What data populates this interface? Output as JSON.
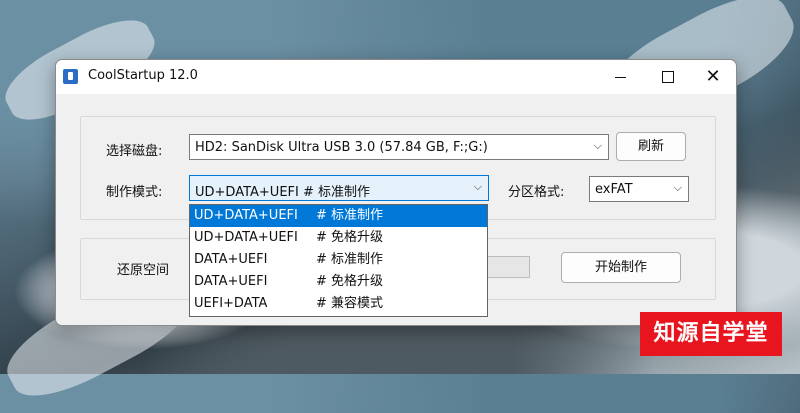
{
  "window": {
    "title": "CoolStartup 12.0",
    "controls": {
      "minimize": "",
      "maximize": "",
      "close": "✕"
    }
  },
  "disk": {
    "label": "选择磁盘:",
    "value": "HD2: SanDisk Ultra USB 3.0 (57.84 GB, F:;G:)",
    "refresh_label": "刷新"
  },
  "mode": {
    "label": "制作模式:",
    "value_mode": "UD+DATA+UEFI",
    "value_desc": "# 标准制作",
    "options": [
      {
        "mode": "UD+DATA+UEFI",
        "desc": "# 标准制作",
        "selected": true
      },
      {
        "mode": "UD+DATA+UEFI",
        "desc": "# 免格升级",
        "selected": false
      },
      {
        "mode": "DATA+UEFI",
        "desc": "# 标准制作",
        "selected": false
      },
      {
        "mode": "DATA+UEFI",
        "desc": "# 免格升级",
        "selected": false
      },
      {
        "mode": "UEFI+DATA",
        "desc": "# 兼容模式",
        "selected": false
      }
    ]
  },
  "partition": {
    "label": "分区格式:",
    "value": "exFAT"
  },
  "restore": {
    "label": "还原空间",
    "start_label": "开始制作"
  },
  "watermark": {
    "text": "知源自学堂"
  },
  "colors": {
    "accent": "#0078d7",
    "watermark_bg": "#e8151f"
  }
}
